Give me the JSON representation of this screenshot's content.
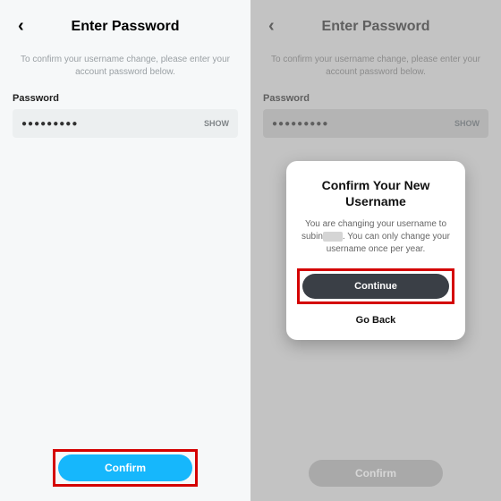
{
  "header": {
    "title": "Enter Password",
    "back_glyph": "‹"
  },
  "subtitle": "To confirm your username change, please enter your account password below.",
  "password": {
    "label": "Password",
    "masked_value": "●●●●●●●●●",
    "show_label": "SHOW"
  },
  "confirm_button": "Confirm",
  "modal": {
    "title": "Confirm Your New Username",
    "body_prefix": "You are changing your username to subin",
    "body_suffix": ". You can only change your username once per year.",
    "continue_label": "Continue",
    "go_back_label": "Go Back"
  }
}
